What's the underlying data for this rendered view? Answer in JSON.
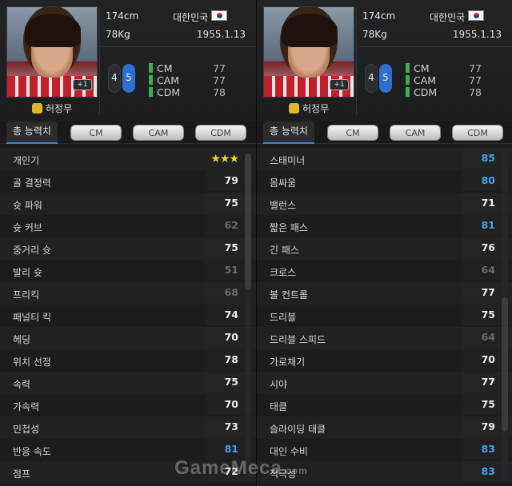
{
  "player": {
    "name": "허정무",
    "height": "174cm",
    "weight": "78Kg",
    "nation": "대한민국",
    "birth": "1955.1.13",
    "foot_left": "4",
    "foot_right": "5",
    "photo_badge": "+1",
    "positions": [
      {
        "label": "CM",
        "value": "77"
      },
      {
        "label": "CAM",
        "value": "77"
      },
      {
        "label": "CDM",
        "value": "78"
      }
    ]
  },
  "tabs": {
    "active": "총 능력치",
    "items": [
      "CM",
      "CAM",
      "CDM"
    ]
  },
  "stats_left": [
    {
      "label": "개인기",
      "value": "★★★",
      "tone": "star"
    },
    {
      "label": "골 결정력",
      "value": "79",
      "tone": "w"
    },
    {
      "label": "슛 파워",
      "value": "75",
      "tone": "w"
    },
    {
      "label": "슛 커브",
      "value": "62",
      "tone": "g"
    },
    {
      "label": "중거리 슛",
      "value": "75",
      "tone": "w"
    },
    {
      "label": "발리 슛",
      "value": "51",
      "tone": "g"
    },
    {
      "label": "프리킥",
      "value": "68",
      "tone": "g"
    },
    {
      "label": "패널티 킥",
      "value": "74",
      "tone": "w"
    },
    {
      "label": "헤딩",
      "value": "70",
      "tone": "w"
    },
    {
      "label": "위치 선정",
      "value": "78",
      "tone": "w"
    },
    {
      "label": "속력",
      "value": "75",
      "tone": "w"
    },
    {
      "label": "가속력",
      "value": "70",
      "tone": "w"
    },
    {
      "label": "민첩성",
      "value": "73",
      "tone": "w"
    },
    {
      "label": "반응 속도",
      "value": "81",
      "tone": "b"
    },
    {
      "label": "점프",
      "value": "72",
      "tone": "w"
    }
  ],
  "stats_right": [
    {
      "label": "스태미너",
      "value": "85",
      "tone": "b"
    },
    {
      "label": "몸싸움",
      "value": "80",
      "tone": "b"
    },
    {
      "label": "밸런스",
      "value": "71",
      "tone": "w"
    },
    {
      "label": "짧은 패스",
      "value": "81",
      "tone": "b"
    },
    {
      "label": "긴 패스",
      "value": "76",
      "tone": "w"
    },
    {
      "label": "크로스",
      "value": "64",
      "tone": "g"
    },
    {
      "label": "볼 컨트롤",
      "value": "77",
      "tone": "w"
    },
    {
      "label": "드리블",
      "value": "75",
      "tone": "w"
    },
    {
      "label": "드리블 스피드",
      "value": "64",
      "tone": "g"
    },
    {
      "label": "가로채기",
      "value": "70",
      "tone": "w"
    },
    {
      "label": "시야",
      "value": "77",
      "tone": "w"
    },
    {
      "label": "태클",
      "value": "75",
      "tone": "w"
    },
    {
      "label": "슬라이딩 태클",
      "value": "79",
      "tone": "w"
    },
    {
      "label": "대인 수비",
      "value": "83",
      "tone": "b"
    },
    {
      "label": "적극성",
      "value": "83",
      "tone": "b"
    }
  ],
  "watermark": "GameMeca",
  "watermark_suffix": ".com",
  "colors": {
    "high": "#3da8ea",
    "low": "#666a6e",
    "normal": "#ececec",
    "position_bar": "#37b34a",
    "star": "#f0d230"
  }
}
